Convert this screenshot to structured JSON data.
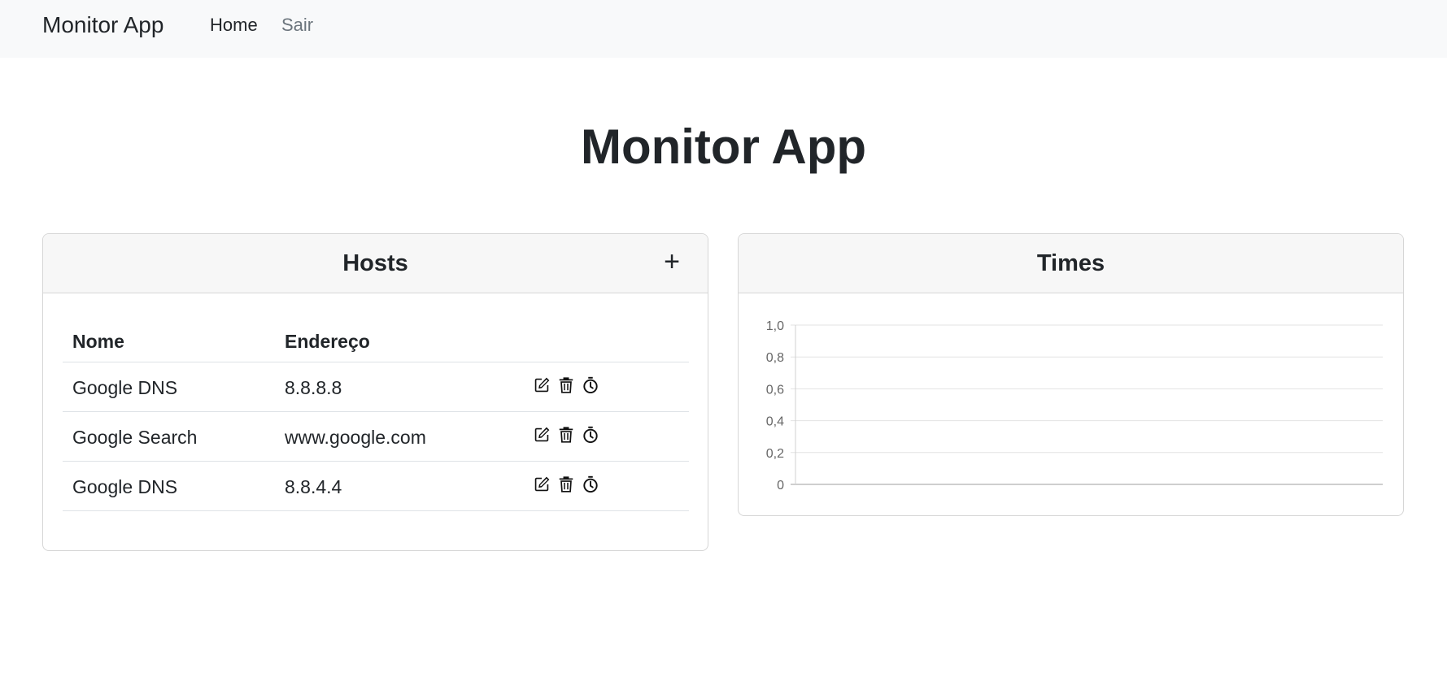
{
  "navbar": {
    "brand": "Monitor App",
    "links": [
      {
        "label": "Home"
      },
      {
        "label": "Sair"
      }
    ]
  },
  "page": {
    "title": "Monitor App"
  },
  "hosts": {
    "title": "Hosts",
    "add_icon": "+",
    "columns": [
      "Nome",
      "Endereço"
    ],
    "rows": [
      {
        "nome": "Google DNS",
        "endereco": "8.8.8.8"
      },
      {
        "nome": "Google Search",
        "endereco": "www.google.com"
      },
      {
        "nome": "Google DNS",
        "endereco": "8.8.4.4"
      }
    ],
    "row_action_icons": [
      "edit-icon",
      "trash-icon",
      "stopwatch-icon"
    ]
  },
  "times": {
    "title": "Times"
  },
  "chart_data": {
    "type": "line",
    "series": [],
    "ylim": [
      0,
      1
    ],
    "yticks": [
      "0",
      "0,2",
      "0,4",
      "0,6",
      "0,8",
      "1,0"
    ],
    "grid": true
  }
}
